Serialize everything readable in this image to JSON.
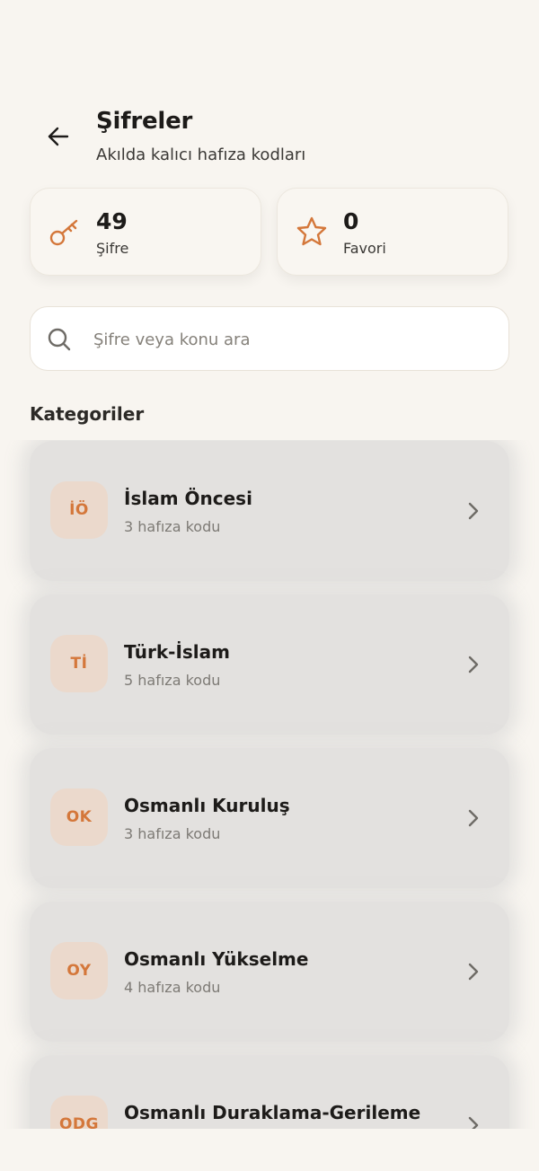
{
  "header": {
    "title": "Şifreler",
    "subtitle": "Akılda kalıcı hafıza kodları"
  },
  "stats": [
    {
      "value": "49",
      "label": "Şifre",
      "icon": "key-icon"
    },
    {
      "value": "0",
      "label": "Favori",
      "icon": "star-icon"
    }
  ],
  "search": {
    "placeholder": "Şifre veya konu ara",
    "value": ""
  },
  "section": {
    "title": "Kategoriler"
  },
  "categories": [
    {
      "badge": "İÖ",
      "name": "İslam Öncesi",
      "count": "3 hafıza kodu"
    },
    {
      "badge": "Tİ",
      "name": "Türk-İslam",
      "count": "5 hafıza kodu"
    },
    {
      "badge": "OK",
      "name": "Osmanlı Kuruluş",
      "count": "3 hafıza kodu"
    },
    {
      "badge": "OY",
      "name": "Osmanlı Yükselme",
      "count": "4 hafıza kodu"
    },
    {
      "badge": "ODG",
      "name": "Osmanlı Duraklama-Gerileme",
      "count": ""
    }
  ],
  "colors": {
    "accent": "#d4773a",
    "background": "#f8f5f0",
    "badge_bg": "#ebd9cc"
  }
}
